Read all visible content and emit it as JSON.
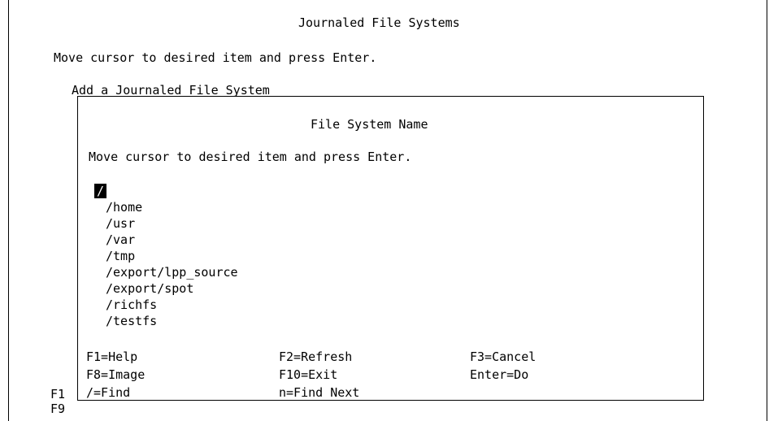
{
  "screen": {
    "title": "Journaled File Systems",
    "instruction": "Move cursor to desired item and press Enter.",
    "menu_item": "Add a Journaled File System",
    "bg_fkeys": [
      "F1",
      "F9"
    ]
  },
  "dialog": {
    "title": "File System Name",
    "instruction": "Move cursor to desired item and press Enter.",
    "items": [
      "/",
      "/home",
      "/usr",
      "/var",
      "/tmp",
      "/export/lpp_source",
      "/export/spot",
      "/richfs",
      "/testfs"
    ],
    "selected_index": 0,
    "function_keys": [
      [
        "F1=Help",
        "F2=Refresh",
        "F3=Cancel"
      ],
      [
        "F8=Image",
        "F10=Exit",
        "Enter=Do"
      ],
      [
        "/=Find",
        "n=Find Next",
        ""
      ]
    ]
  },
  "colors": {
    "background": "#ffffff",
    "foreground": "#000000",
    "cursor_bg": "#000000",
    "cursor_fg": "#ffffff"
  }
}
